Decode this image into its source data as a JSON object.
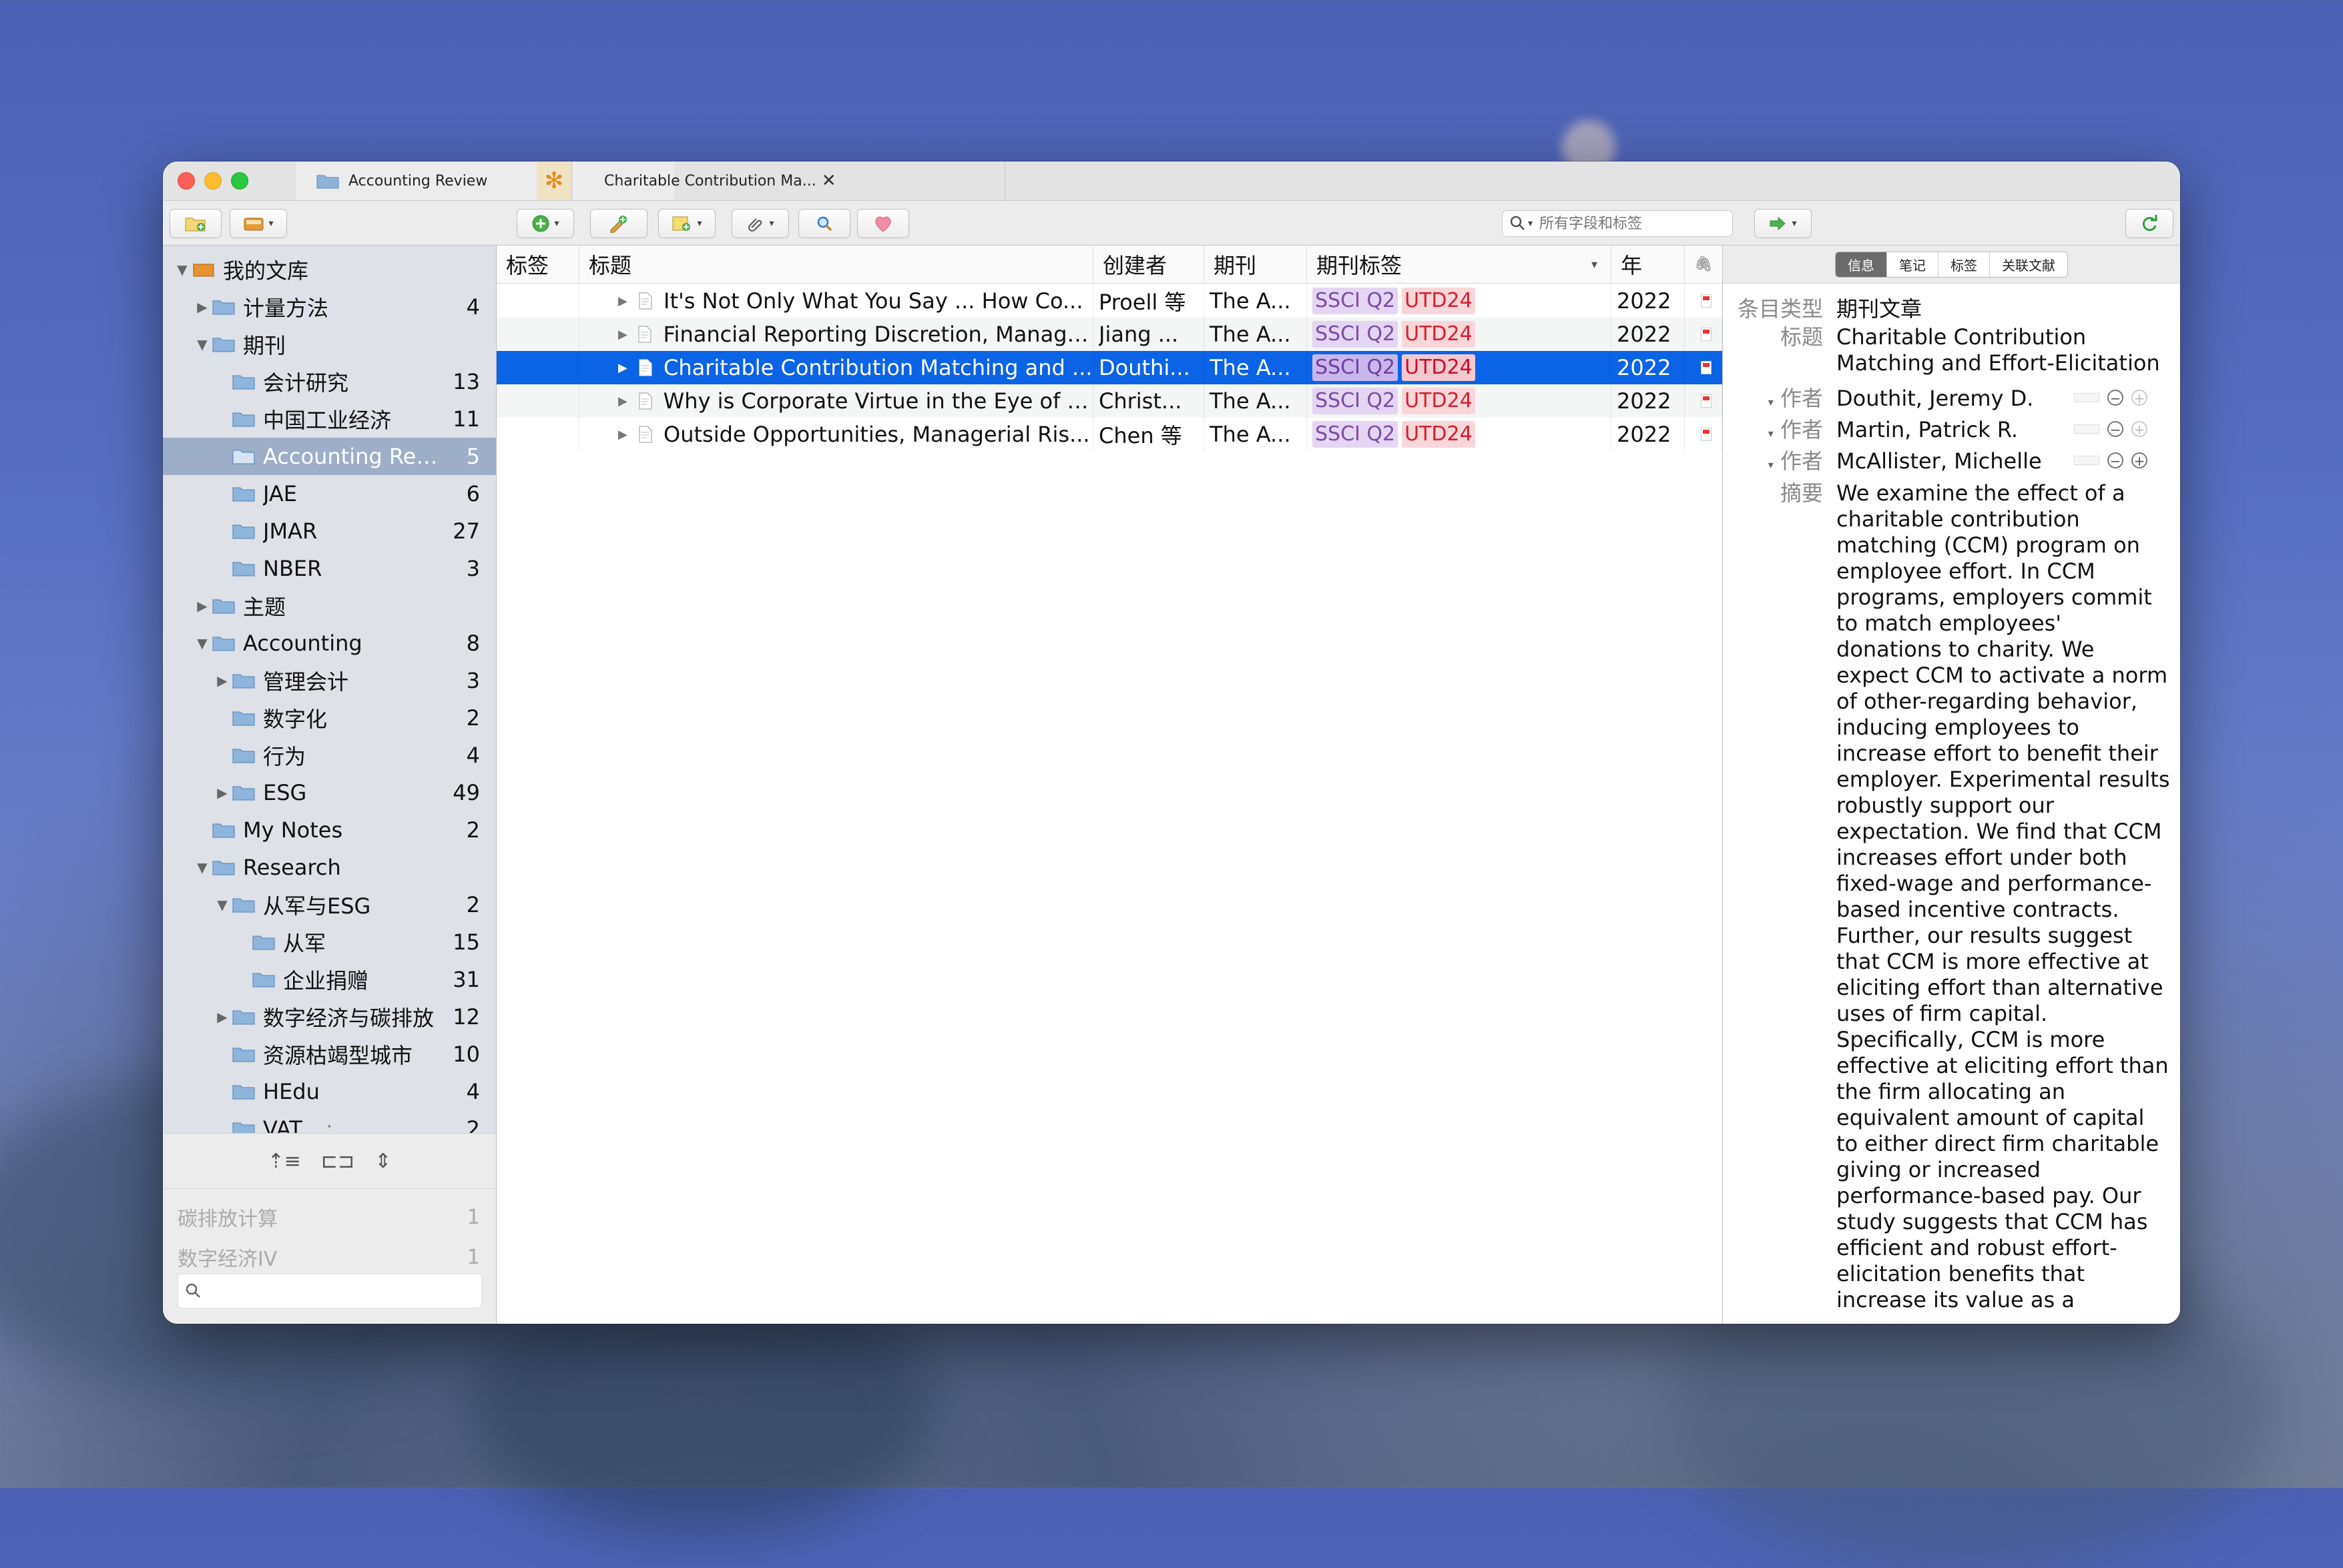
{
  "tabs": [
    {
      "label": "Accounting Review",
      "active": true
    },
    {
      "label": "Charitable Contribution Ma...",
      "active": false
    }
  ],
  "toolbar": {
    "search_placeholder": "所有字段和标签",
    "icons": [
      "new-collection-icon",
      "library-menu-icon",
      "new-item-icon",
      "add-by-identifier-icon",
      "new-note-icon",
      "attachment-icon",
      "advanced-search-icon",
      "heart-plugin-icon",
      "locate-icon",
      "sync-icon"
    ]
  },
  "library": {
    "items": [
      {
        "label": "我的文库",
        "count": "",
        "level": 0,
        "toggle": "open",
        "root": true
      },
      {
        "label": "计量方法",
        "count": "4",
        "level": 1,
        "toggle": "closed"
      },
      {
        "label": "期刊",
        "count": "",
        "level": 1,
        "toggle": "open"
      },
      {
        "label": "会计研究",
        "count": "13",
        "level": 2,
        "toggle": ""
      },
      {
        "label": "中国工业经济",
        "count": "11",
        "level": 2,
        "toggle": ""
      },
      {
        "label": "Accounting Rev...",
        "count": "5",
        "level": 2,
        "toggle": "",
        "selected": true
      },
      {
        "label": "JAE",
        "count": "6",
        "level": 2,
        "toggle": ""
      },
      {
        "label": "JMAR",
        "count": "27",
        "level": 2,
        "toggle": ""
      },
      {
        "label": "NBER",
        "count": "3",
        "level": 2,
        "toggle": ""
      },
      {
        "label": "主题",
        "count": "",
        "level": 1,
        "toggle": "closed"
      },
      {
        "label": "Accounting",
        "count": "8",
        "level": 1,
        "toggle": "open"
      },
      {
        "label": "管理会计",
        "count": "3",
        "level": 2,
        "toggle": "closed"
      },
      {
        "label": "数字化",
        "count": "2",
        "level": 2,
        "toggle": ""
      },
      {
        "label": "行为",
        "count": "4",
        "level": 2,
        "toggle": ""
      },
      {
        "label": "ESG",
        "count": "49",
        "level": 2,
        "toggle": "closed"
      },
      {
        "label": "My Notes",
        "count": "2",
        "level": 1,
        "toggle": ""
      },
      {
        "label": "Research",
        "count": "",
        "level": 1,
        "toggle": "open"
      },
      {
        "label": "从军与ESG",
        "count": "2",
        "level": 2,
        "toggle": "open"
      },
      {
        "label": "从军",
        "count": "15",
        "level": 3,
        "toggle": ""
      },
      {
        "label": "企业捐赠",
        "count": "31",
        "level": 3,
        "toggle": ""
      },
      {
        "label": "数字经济与碳排放",
        "count": "12",
        "level": 2,
        "toggle": "closed"
      },
      {
        "label": "资源枯竭型城市",
        "count": "10",
        "level": 2,
        "toggle": ""
      },
      {
        "label": "HEdu",
        "count": "4",
        "level": 2,
        "toggle": ""
      },
      {
        "label": "VAT",
        "count": "2",
        "level": 2,
        "toggle": ""
      }
    ],
    "tag_selector": [
      {
        "label": "碳排放计算",
        "count": "1"
      },
      {
        "label": "数字经济IV",
        "count": "1"
      }
    ]
  },
  "columns": [
    "标签",
    "标题",
    "创建者",
    "期刊",
    "期刊标签",
    "年"
  ],
  "rows": [
    {
      "title": "It's Not Only What You Say ... How Co...",
      "creator": "Proell 等",
      "journal": "The A...",
      "badges": [
        "SSCI Q2",
        "UTD24"
      ],
      "year": "2022"
    },
    {
      "title": "Financial Reporting Discretion, Manage...",
      "creator": "Jiang ...",
      "journal": "The A...",
      "badges": [
        "SSCI Q2",
        "UTD24"
      ],
      "year": "2022"
    },
    {
      "title": "Charitable Contribution Matching and ...",
      "creator": "Douthi...",
      "journal": "The A...",
      "badges": [
        "SSCI Q2",
        "UTD24"
      ],
      "year": "2022",
      "selected": true
    },
    {
      "title": "Why is Corporate Virtue in the Eye of T...",
      "creator": "Christ...",
      "journal": "The A...",
      "badges": [
        "SSCI Q2",
        "UTD24"
      ],
      "year": "2022"
    },
    {
      "title": "Outside Opportunities, Managerial Ris...",
      "creator": "Chen 等",
      "journal": "The A...",
      "badges": [
        "SSCI Q2",
        "UTD24"
      ],
      "year": "2022"
    }
  ],
  "detail": {
    "tabs": [
      "信息",
      "笔记",
      "标签",
      "关联文献"
    ],
    "item_type_label": "条目类型",
    "item_type": "期刊文章",
    "title_label": "标题",
    "title": "Charitable Contribution Matching and Effort-Elicitation",
    "author_label": "作者",
    "authors": [
      "Douthit, Jeremy D.",
      "Martin, Patrick R.",
      "McAllister, Michelle"
    ],
    "abstract_label": "摘要",
    "abstract": "We examine the effect of a charitable contribution matching (CCM) program on employee effort. In CCM programs, employers commit to match employees' donations to charity. We expect CCM to activate a norm of other-regarding behavior, inducing employees to increase effort to benefit their employer. Experimental results robustly support our expectation. We find that CCM increases effort under both fixed-wage and performance-based incentive contracts. Further, our results suggest that CCM is more effective at eliciting effort than alternative uses of firm capital. Specifically, CCM is more effective at eliciting effort than the firm allocating an equivalent amount of capital to either direct firm charitable giving or increased performance-based pay. Our study suggests that CCM has efficient and robust effort-elicitation benefits that increase its value as a"
  },
  "colors": {
    "selection": "#0b63e5",
    "sidebar_selection": "#9daec8",
    "badge_ssci_bg": "#e4d5f2",
    "badge_ssci_fg": "#7d4aa6",
    "badge_utd_bg": "#f8d6d9",
    "badge_utd_fg": "#d4202e"
  }
}
